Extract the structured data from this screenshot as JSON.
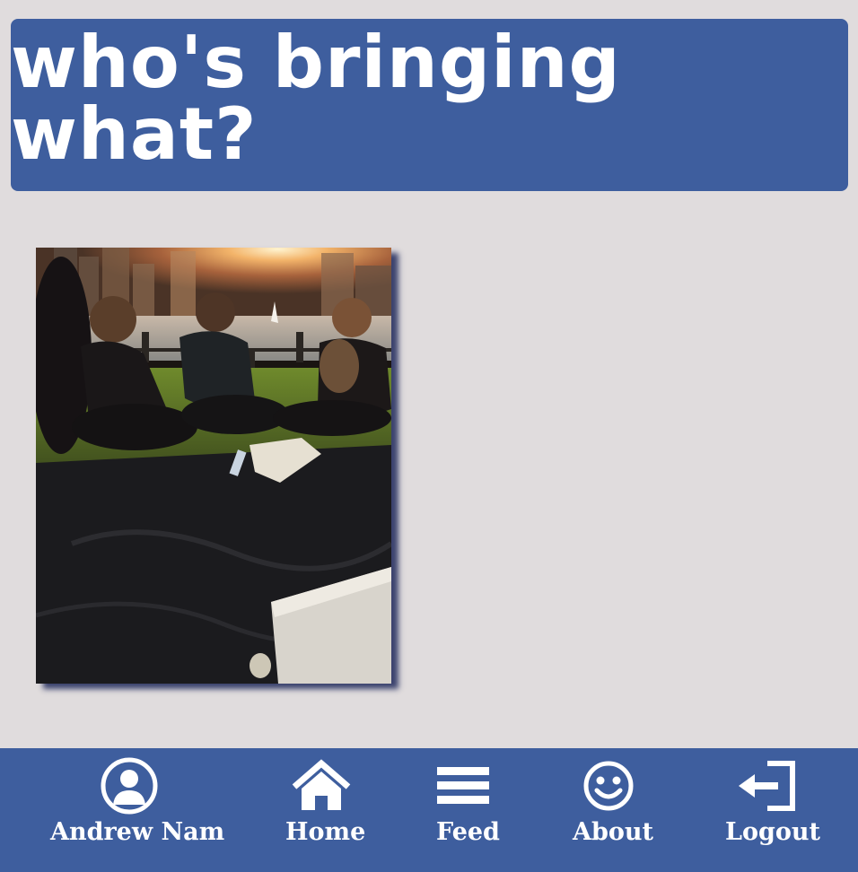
{
  "header": {
    "title": "who's bringing what?"
  },
  "photo": {
    "alt": "friends picnicking on grass by the river at sunset"
  },
  "nav": {
    "items": [
      {
        "label": "Andrew Nam",
        "icon": "user-circle-icon"
      },
      {
        "label": "Home",
        "icon": "home-icon"
      },
      {
        "label": "Feed",
        "icon": "menu-lines-icon"
      },
      {
        "label": "About",
        "icon": "smiley-icon"
      },
      {
        "label": "Logout",
        "icon": "logout-icon"
      }
    ]
  },
  "colors": {
    "background": "#e0dcdd",
    "brand_blue": "#3e5e9e",
    "text_white": "#ffffff"
  }
}
